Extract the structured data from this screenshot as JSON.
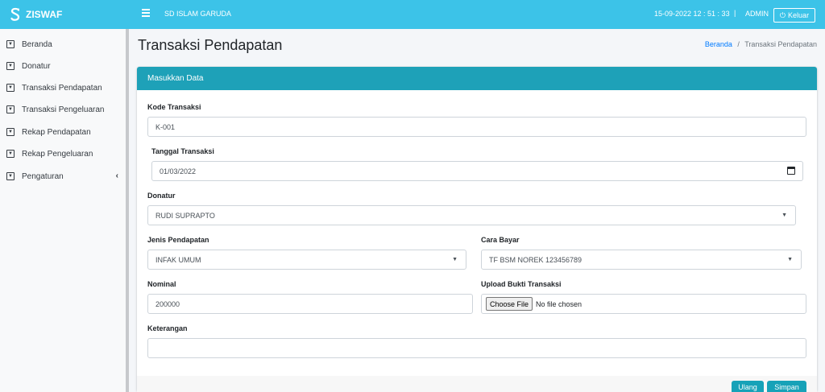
{
  "topbar": {
    "brand": "ZISWAF",
    "school": "SD ISLAM GARUDA",
    "datetime": "15-09-2022 12 : 51 : 33",
    "separator": "|",
    "user": "ADMIN",
    "logout_label": "Keluar"
  },
  "sidebar": {
    "items": [
      {
        "label": "Beranda"
      },
      {
        "label": "Donatur"
      },
      {
        "label": "Transaksi Pendapatan"
      },
      {
        "label": "Transaksi Pengeluaran"
      },
      {
        "label": "Rekap Pendapatan"
      },
      {
        "label": "Rekap Pengeluaran"
      },
      {
        "label": "Pengaturan"
      }
    ],
    "chevron": "‹"
  },
  "page": {
    "title": "Transaksi Pendapatan",
    "breadcrumb_home": "Beranda",
    "breadcrumb_sep": "/",
    "breadcrumb_current": "Transaksi Pendapatan"
  },
  "form": {
    "header": "Masukkan Data",
    "kode_label": "Kode Transaksi",
    "kode_value": "K-001",
    "tanggal_label": "Tanggal Transaksi",
    "tanggal_value": "01/03/2022",
    "donatur_label": "Donatur",
    "donatur_value": "RUDI SUPRAPTO",
    "jenis_label": "Jenis Pendapatan",
    "jenis_value": "INFAK UMUM",
    "cara_label": "Cara Bayar",
    "cara_value": "TF BSM NOREK 123456789",
    "nominal_label": "Nominal",
    "nominal_value": "200000",
    "upload_label": "Upload Bukti Transaksi",
    "file_button": "Choose File",
    "file_status": "No file chosen",
    "keterangan_label": "Keterangan",
    "keterangan_value": "",
    "reset_label": "Ulang",
    "submit_label": "Simpan"
  },
  "colors": {
    "topbar": "#3cc3e8",
    "card_header": "#1ea1b8",
    "button": "#17a2b8",
    "link": "#007bff"
  }
}
